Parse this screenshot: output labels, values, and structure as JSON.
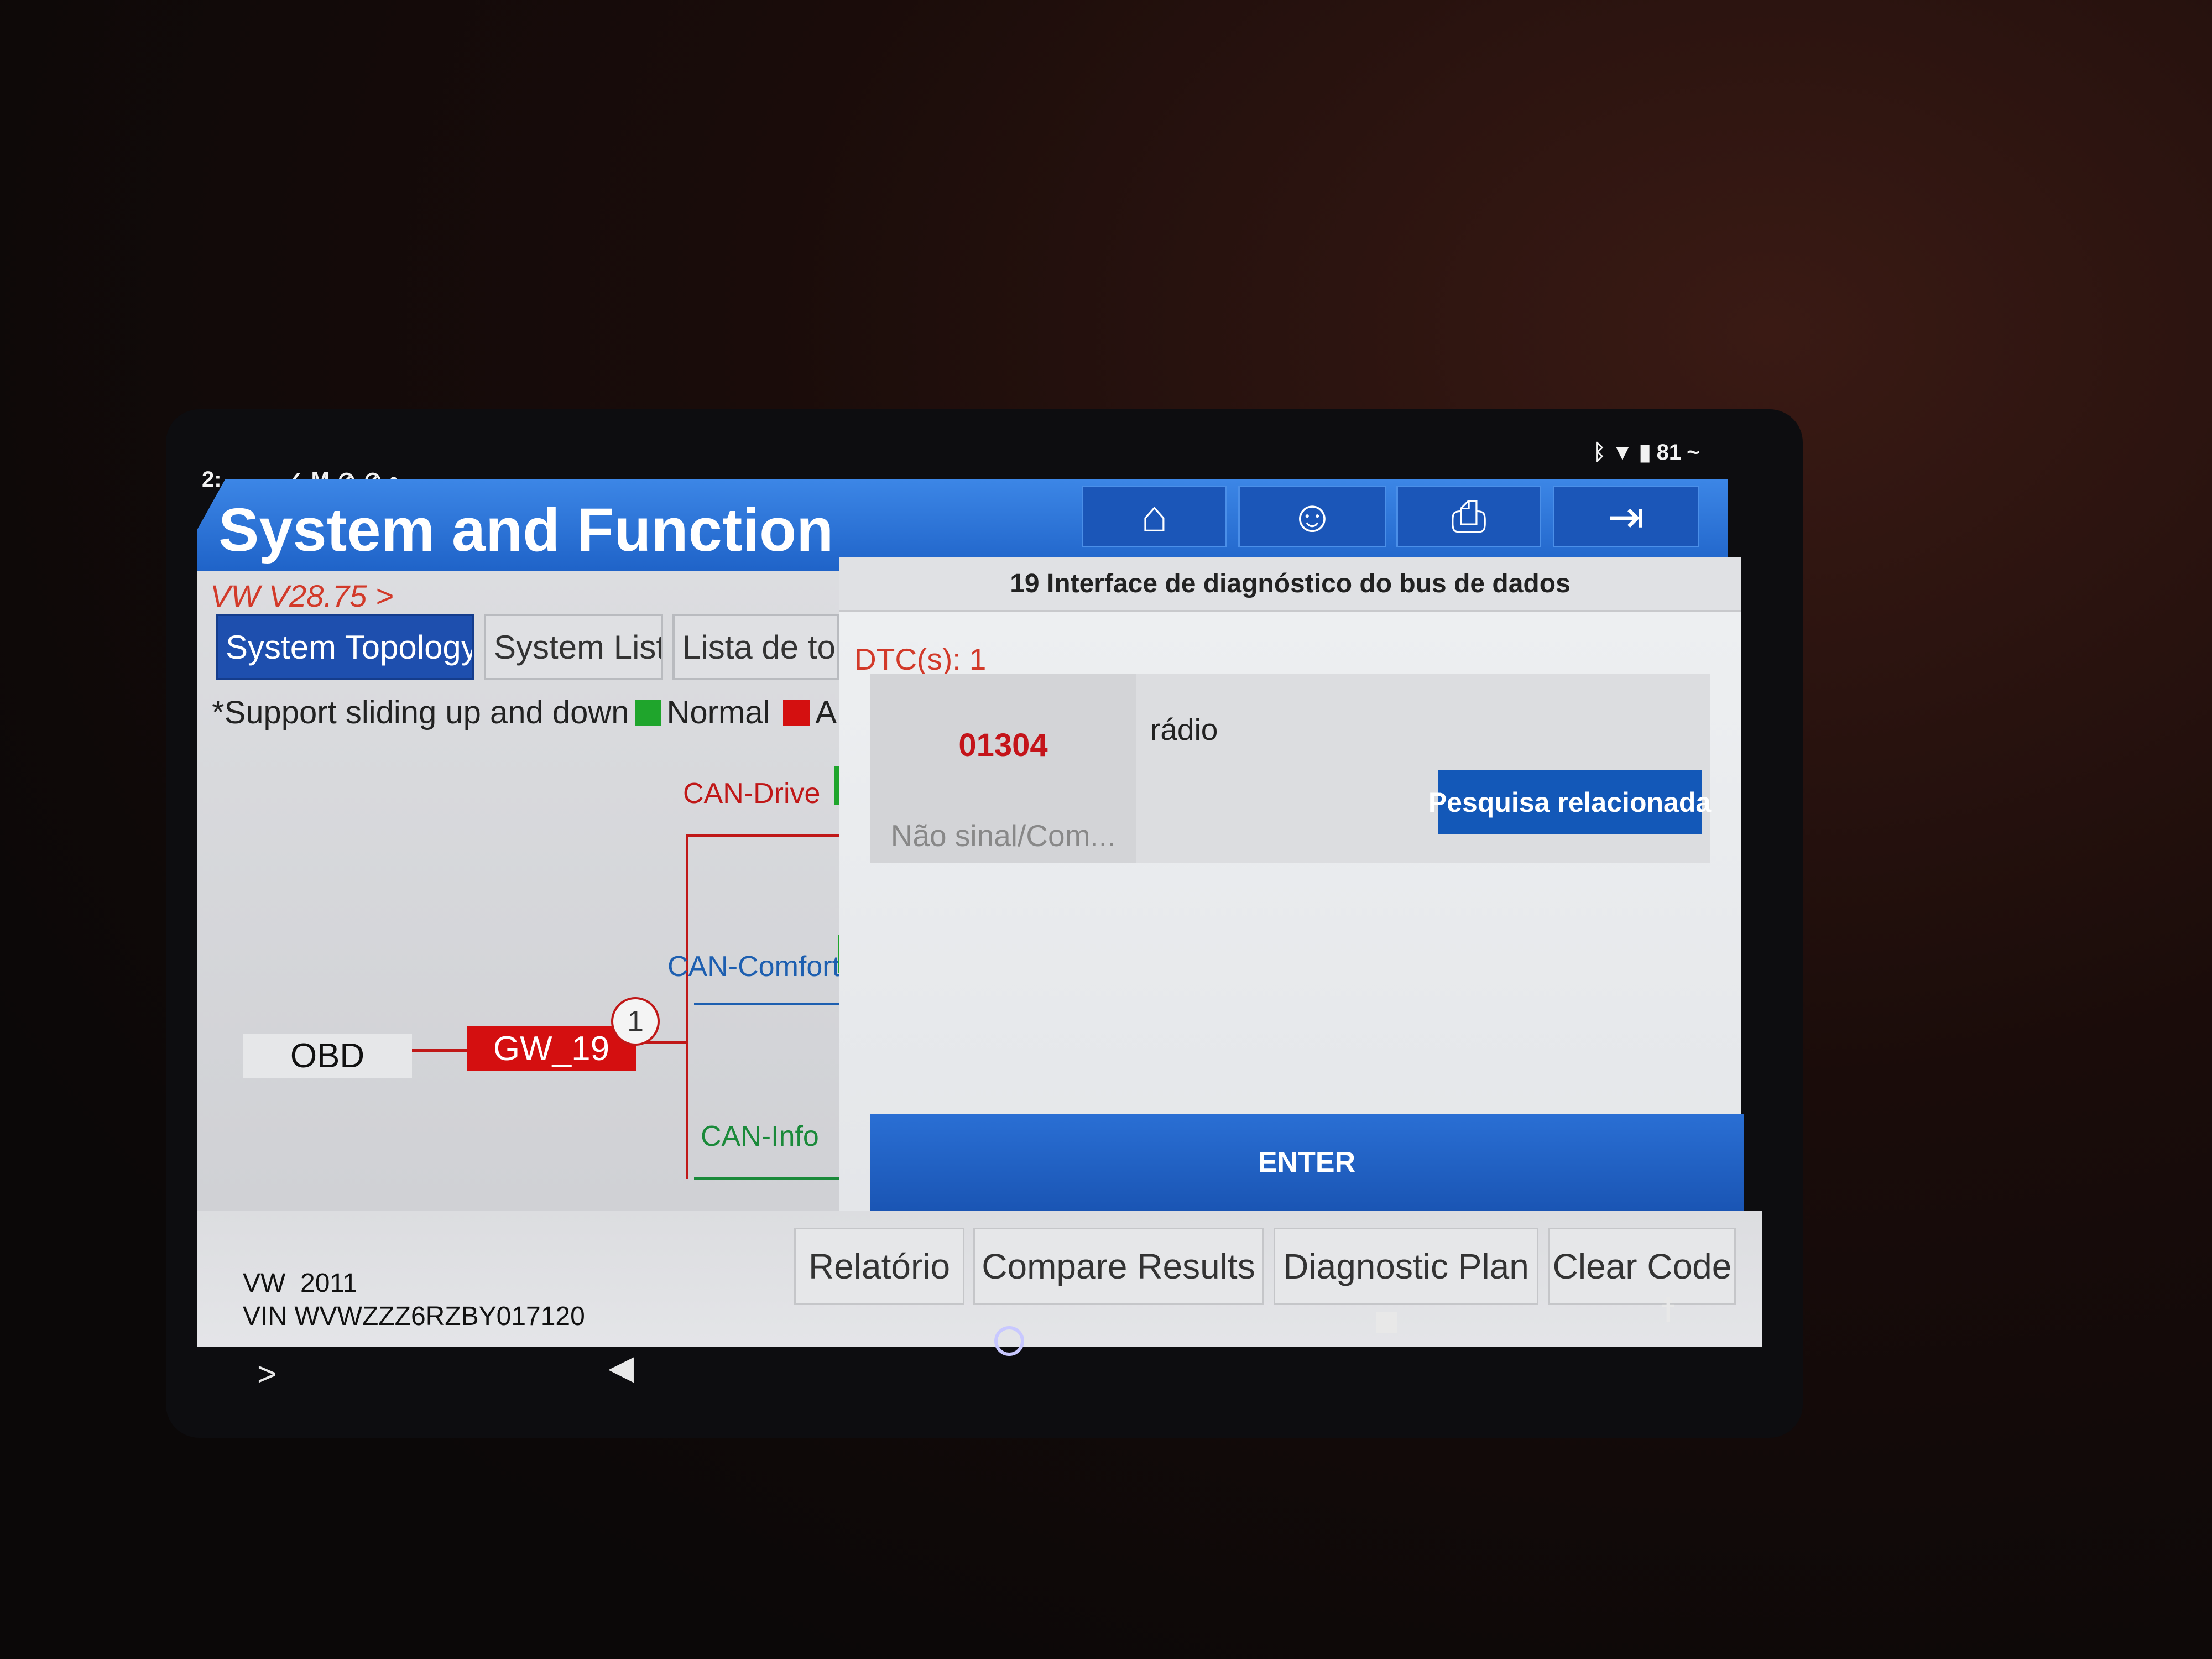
{
  "status_bar": {
    "left_text": "2:",
    "battery": "81",
    "icons": [
      "notification-icon",
      "gmail-icon",
      "blocked-icon",
      "blocked-icon",
      "dot-icon",
      "bluetooth-icon",
      "data-arrows-icon",
      "wifi-icon",
      "battery-icon",
      "charging-icon"
    ]
  },
  "header": {
    "title": "System and Function",
    "buttons": [
      {
        "icon": "home-icon"
      },
      {
        "icon": "support-user-icon"
      },
      {
        "icon": "print-icon"
      },
      {
        "icon": "exit-icon"
      }
    ],
    "color": "#1f63c8"
  },
  "left": {
    "version": "VW V28.75 >",
    "tabs": [
      {
        "label": "System Topology",
        "active": true
      },
      {
        "label": "System List",
        "active": false
      },
      {
        "label": "Lista de to",
        "active": false
      }
    ],
    "legend_hint": "*Support sliding up and down",
    "legend": [
      {
        "label": "Normal",
        "color": "#1fa52c"
      },
      {
        "label": "A",
        "color": "#d41010"
      }
    ],
    "topology": {
      "obd": "OBD",
      "gateway": "GW_19",
      "gateway_badge": "1",
      "buses": [
        {
          "label": "CAN-Drive",
          "color": "#c01818"
        },
        {
          "label": "CAN-Comfort",
          "color": "#1d5fb0"
        },
        {
          "label": "CAN-Info",
          "color": "#1a8a3a"
        }
      ]
    }
  },
  "dialog": {
    "title": "19 Interface de diagnóstico do bus de dados",
    "dtc_count": "DTC(s): 1",
    "dtcs": [
      {
        "code": "01304",
        "status": "Não sinal/Com...",
        "description": "rádio",
        "action": "Pesquisa relacionada"
      }
    ],
    "enter": "ENTER"
  },
  "bottom_buttons": [
    "Relatório",
    "Compare Results",
    "Diagnostic Plan",
    "Clear Code"
  ],
  "vehicle": {
    "make_year": "VW  2011",
    "vin": "VIN WVWZZZ6RZBY017120"
  },
  "nav": {
    "icons": [
      "expand-icon",
      "back-icon",
      "home-circle-icon",
      "recents-icon",
      "accessibility-icon"
    ],
    "expand": ">"
  }
}
